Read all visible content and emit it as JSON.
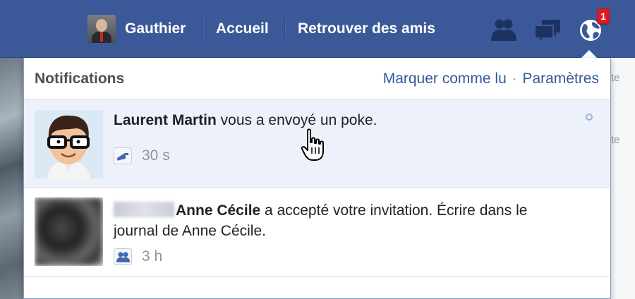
{
  "topbar": {
    "user_name": "Gauthier",
    "home_label": "Accueil",
    "find_friends_label": "Retrouver des amis",
    "notification_count": "1",
    "brand_color": "#3b5998"
  },
  "dropdown": {
    "title": "Notifications",
    "mark_read_label": "Marquer comme lu",
    "separator": "·",
    "settings_label": "Paramètres"
  },
  "notifications": [
    {
      "actor": "Laurent Martin",
      "text": " vous a envoyé un poke.",
      "time": "30 s",
      "icon": "poke-icon",
      "unread": true
    },
    {
      "actor": "Anne Cécile",
      "text": " a accepté votre invitation. Écrire dans le journal de Anne Cécile.",
      "time": "3 h",
      "icon": "friends-icon",
      "unread": false
    }
  ],
  "background": {
    "fragment_1": "te",
    "fragment_2": "te"
  }
}
